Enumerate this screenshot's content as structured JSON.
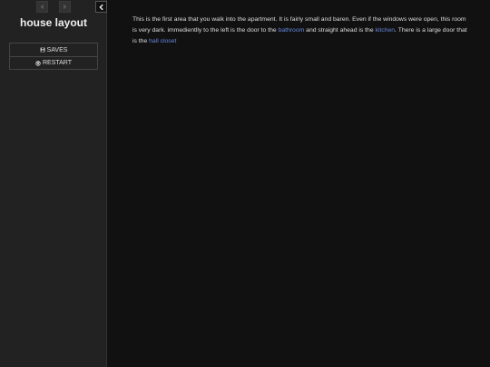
{
  "sidebar": {
    "title": "house layout",
    "nav": {
      "back_icon": "arrow-left-icon",
      "forward_icon": "arrow-right-icon",
      "collapse_icon": "chevron-left-icon"
    },
    "menu": [
      {
        "label": "SAVES",
        "icon": "save-icon"
      },
      {
        "label": "RESTART",
        "icon": "power-icon"
      }
    ]
  },
  "passage": {
    "t1": "This is the first area that you walk into the apartment. It is fairly small and baren. Even if the windows were open, this room is very dark. immedientlly to the left is the door to the ",
    "link_bathroom": "bathroom",
    "t2": " and straight ahead is the ",
    "link_kitchen": "kitchen",
    "t3": ". There is a large door that is the ",
    "link_hall_closet": "hall closet"
  },
  "colors": {
    "sidebar_bg": "#222222",
    "main_bg": "#111111",
    "text": "#dddddd",
    "link": "#6688dd"
  }
}
